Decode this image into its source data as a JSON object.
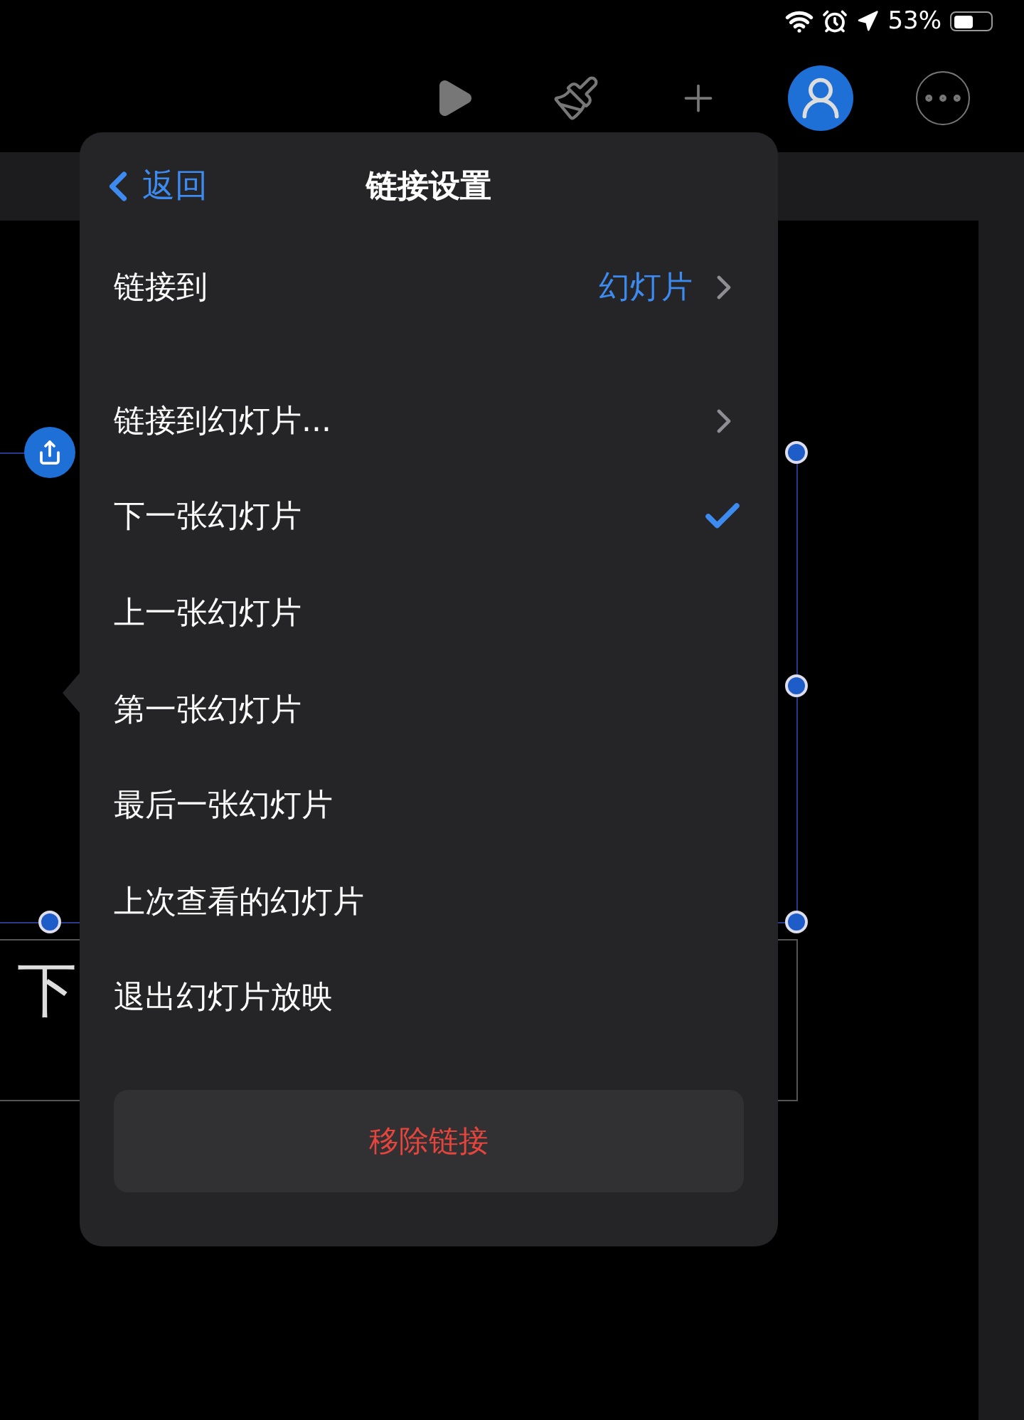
{
  "status_bar": {
    "battery": "53%"
  },
  "slide": {
    "subtitle_fragment": "下"
  },
  "popover": {
    "back": "返回",
    "title": "链接设置",
    "link_to": {
      "label": "链接到",
      "value": "幻灯片"
    },
    "options": [
      {
        "label": "链接到幻灯片...",
        "kind": "submenu",
        "selected": false
      },
      {
        "label": "下一张幻灯片",
        "kind": "option",
        "selected": true
      },
      {
        "label": "上一张幻灯片",
        "kind": "option",
        "selected": false
      },
      {
        "label": "第一张幻灯片",
        "kind": "option",
        "selected": false
      },
      {
        "label": "最后一张幻灯片",
        "kind": "option",
        "selected": false
      },
      {
        "label": "上次查看的幻灯片",
        "kind": "option",
        "selected": false
      },
      {
        "label": "退出幻灯片放映",
        "kind": "option",
        "selected": false
      }
    ],
    "remove": "移除链接"
  }
}
